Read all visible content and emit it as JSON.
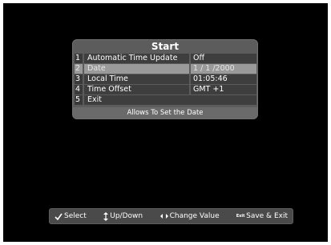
{
  "menu": {
    "title": "Start",
    "rows": [
      {
        "num": "1",
        "label": "Automatic Time Update",
        "value": "Off"
      },
      {
        "num": "2",
        "label": "Date",
        "value": "1 / 1 /2000"
      },
      {
        "num": "3",
        "label": "Local Time",
        "value": "01:05:46"
      },
      {
        "num": "4",
        "label": "Time Offset",
        "value": "GMT +1"
      },
      {
        "num": "5",
        "label": "Exit"
      }
    ],
    "selected_index": 2,
    "help_text": "Allows To Set the Date"
  },
  "keybar": {
    "select_label": "Select",
    "updown_label": "Up/Down",
    "change_label": "Change Value",
    "save_exit_label": "Save & Exit",
    "exit_icon_text": "Exit"
  },
  "icons": {
    "select": "checkmark-icon",
    "updown": "up-down-arrows-icon",
    "change": "left-right-arrows-icon",
    "save_exit": "exit-key-icon"
  },
  "colors": {
    "background": "#000000",
    "panel": "#5c5c5c",
    "row": "#3e3e3e",
    "selected_row": "#9a9a9a",
    "text": "#ffffff"
  }
}
